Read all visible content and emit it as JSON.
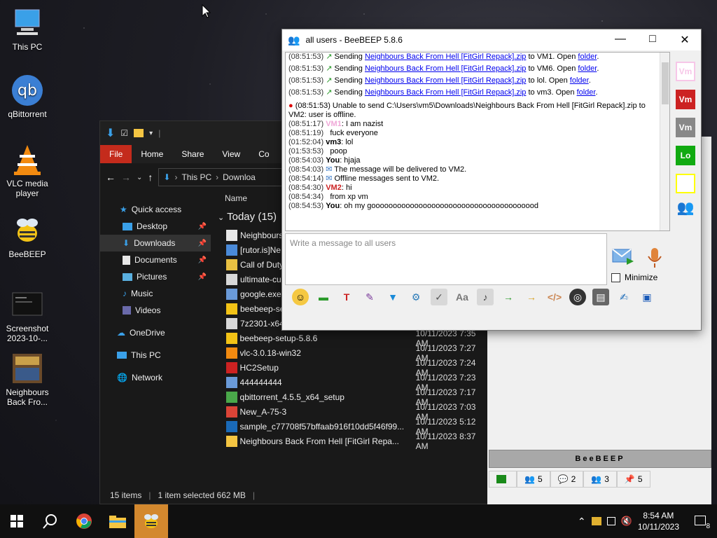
{
  "desktop": {
    "icons": [
      {
        "label": "This PC"
      },
      {
        "label": "qBittorrent"
      },
      {
        "label": "VLC media player"
      },
      {
        "label": "BeeBEEP"
      },
      {
        "label": "Screenshot 2023-10-..."
      },
      {
        "label": "Neighbours Back Fro..."
      }
    ]
  },
  "explorer": {
    "ribbon": [
      "File",
      "Home",
      "Share",
      "View",
      "Co"
    ],
    "breadcrumb": [
      "This PC",
      "Downloa"
    ],
    "column_name": "Name",
    "group": "Today (15)",
    "nav": [
      {
        "label": "Quick access"
      },
      {
        "label": "Desktop"
      },
      {
        "label": "Downloads"
      },
      {
        "label": "Documents"
      },
      {
        "label": "Pictures"
      },
      {
        "label": "Music"
      },
      {
        "label": "Videos"
      },
      {
        "label": "OneDrive"
      },
      {
        "label": "This PC"
      },
      {
        "label": "Network"
      }
    ],
    "files": [
      {
        "name": "Neighbours",
        "date": ""
      },
      {
        "name": "[rutor.is]Ne",
        "date": ""
      },
      {
        "name": "Call of Duty",
        "date": ""
      },
      {
        "name": "ultimate-cu",
        "date": ""
      },
      {
        "name": "google.exe",
        "date": ""
      },
      {
        "name": "beebeep-se",
        "date": ""
      },
      {
        "name": "7z2301-x64",
        "date": ""
      },
      {
        "name": "beebeep-setup-5.8.6",
        "date": "10/11/2023 7:35 AM"
      },
      {
        "name": "vlc-3.0.18-win32",
        "date": "10/11/2023 7:27 AM"
      },
      {
        "name": "HC2Setup",
        "date": "10/11/2023 7:24 AM"
      },
      {
        "name": "444444444",
        "date": "10/11/2023 7:23 AM"
      },
      {
        "name": "qbittorrent_4.5.5_x64_setup",
        "date": "10/11/2023 7:17 AM"
      },
      {
        "name": "New_A-75-3",
        "date": "10/11/2023 7:03 AM"
      },
      {
        "name": "sample_c77708f57bffaab916f10dd5f46f99...",
        "date": "10/11/2023 5:12 AM"
      },
      {
        "name": "Neighbours Back From Hell [FitGirl Repa...",
        "date": "10/11/2023 8:37 AM"
      }
    ],
    "status": {
      "items": "15 items",
      "selected": "1 item selected  662 MB"
    }
  },
  "beebeep": {
    "title": "all users - BeeBEEP 5.8.6",
    "chat": [
      {
        "ts": "(08:51:53)",
        "pre": "Sending ",
        "link": "Neighbours Back From Hell [FitGirl Repack].zip",
        "post": " to VM1. Open ",
        "link2": "folder",
        "end": "."
      },
      {
        "ts": "(08:51:53)",
        "pre": "Sending ",
        "link": "Neighbours Back From Hell [FitGirl Repack].zip",
        "post": " to VM6. Open ",
        "link2": "folder",
        "end": "."
      },
      {
        "ts": "(08:51:53)",
        "pre": "Sending ",
        "link": "Neighbours Back From Hell [FitGirl Repack].zip",
        "post": " to lol. Open ",
        "link2": "folder",
        "end": "."
      },
      {
        "ts": "(08:51:53)",
        "pre": "Sending ",
        "link": "Neighbours Back From Hell [FitGirl Repack].zip",
        "post": " to vm3. Open ",
        "link2": "folder",
        "end": "."
      }
    ],
    "error_line1": "(08:51:53)   Unable to send C:\\Users\\vm5\\Downloads\\Neighbours Back From Hell [FitGirl Repack].zip to",
    "error_line2": "VM2: user is offline.",
    "messages": [
      {
        "ts": "(08:51:17)",
        "who": "VM1",
        "text": ": I am nazist"
      },
      {
        "ts": "(08:51:19)",
        "who": "",
        "text": "fuck everyone"
      },
      {
        "ts": "(01:52:04)",
        "who": "vm3",
        "text": ": lol"
      },
      {
        "ts": "(01:53:53)",
        "who": "",
        "text": "poop"
      },
      {
        "ts": "(08:54:03)",
        "who": "You",
        "text": ": hjaja"
      },
      {
        "ts": "(08:54:03)",
        "who": "",
        "text": "The message will be delivered to VM2."
      },
      {
        "ts": "(08:54:14)",
        "who": "",
        "text": "Offline messages sent to VM2."
      },
      {
        "ts": "(08:54:30)",
        "who": "VM2",
        "text": ": hi"
      },
      {
        "ts": "(08:54:34)",
        "who": "",
        "text": "from xp vm"
      },
      {
        "ts": "(08:54:53)",
        "who": "You",
        "text": ": oh my gooooooooooooooooooooooooooooooooooooood"
      }
    ],
    "input_placeholder": "Write a message to all users",
    "minimize_label": "Minimize",
    "sidebar": [
      "Vm",
      "Vm",
      "Vm",
      "Lo",
      ""
    ],
    "banner": "BeeBEEP",
    "tabs": [
      "",
      "5",
      "2",
      "3",
      "5"
    ]
  },
  "taskbar": {
    "time": "8:54 AM",
    "date": "10/11/2023",
    "notif": "8"
  }
}
